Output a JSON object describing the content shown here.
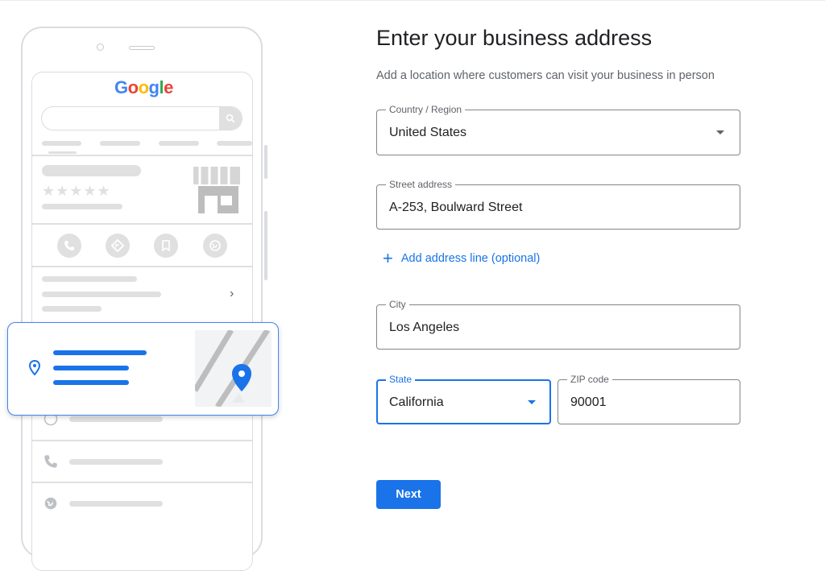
{
  "form": {
    "title": "Enter your business address",
    "subtitle": "Add a location where customers can visit your business in person",
    "country": {
      "label": "Country / Region",
      "value": "United States"
    },
    "street": {
      "label": "Street address",
      "value": "A-253, Boulward Street"
    },
    "add_line": {
      "icon": "plus-icon",
      "label": "Add address line (optional)"
    },
    "city": {
      "label": "City",
      "value": "Los Angeles"
    },
    "state": {
      "label": "State",
      "value": "California"
    },
    "zip": {
      "label": "ZIP code",
      "value": "90001"
    },
    "next_label": "Next"
  },
  "illustration": {
    "logo": "Google",
    "rating_stars": "★★★★★"
  },
  "colors": {
    "accent": "#1a73e8",
    "text": "#202124",
    "muted": "#5f6368",
    "border": "#80868b",
    "placeholder_gray": "#e0e0e0"
  }
}
